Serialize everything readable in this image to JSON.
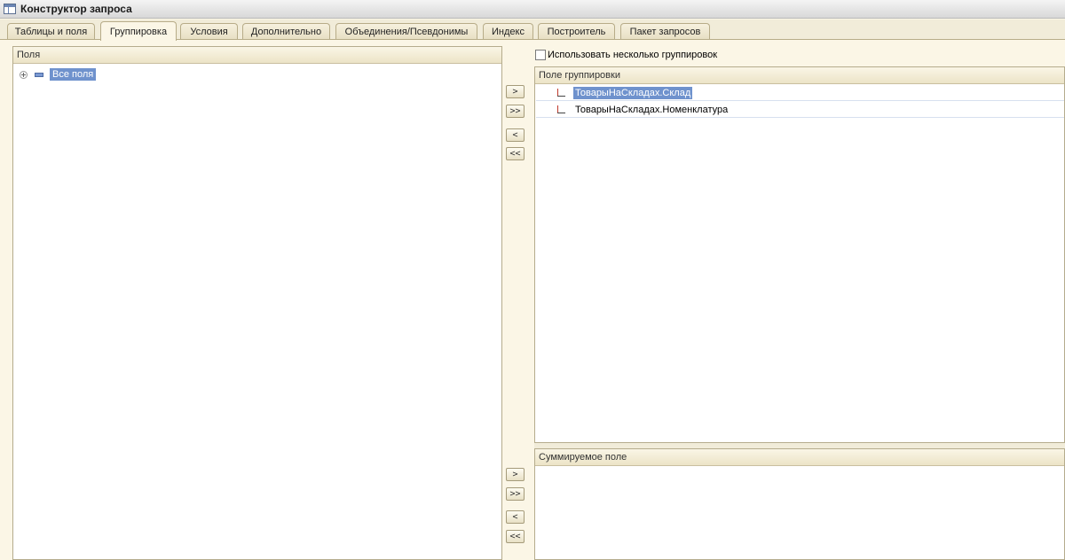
{
  "window": {
    "title": "Конструктор запроса"
  },
  "tabs": [
    {
      "label": "Таблицы и поля",
      "active": false
    },
    {
      "label": "Группировка",
      "active": true
    },
    {
      "label": "Условия",
      "active": false
    },
    {
      "label": "Дополнительно",
      "active": false
    },
    {
      "label": "Объединения/Псевдонимы",
      "active": false
    },
    {
      "label": "Индекс",
      "active": false
    },
    {
      "label": "Построитель",
      "active": false
    },
    {
      "label": "Пакет запросов",
      "active": false
    }
  ],
  "fields_panel": {
    "header": "Поля",
    "items": [
      {
        "label": "Все поля",
        "selected": true
      }
    ]
  },
  "move_buttons": {
    "add": ">",
    "add_all": ">>",
    "remove": "<",
    "remove_all": "<<"
  },
  "options": {
    "multiple_groupings_label": "Использовать несколько группировок",
    "multiple_groupings_checked": false
  },
  "group_panel": {
    "header": "Поле группировки",
    "rows": [
      {
        "label": "ТоварыНаСкладах.Склад",
        "selected": true
      },
      {
        "label": "ТоварыНаСкладах.Номенклатура",
        "selected": false
      }
    ]
  },
  "sum_panel": {
    "header": "Суммируемое поле",
    "rows": []
  },
  "colors": {
    "selection": "#6f92cd",
    "background": "#fbf6e6",
    "border": "#b5ac8d"
  }
}
